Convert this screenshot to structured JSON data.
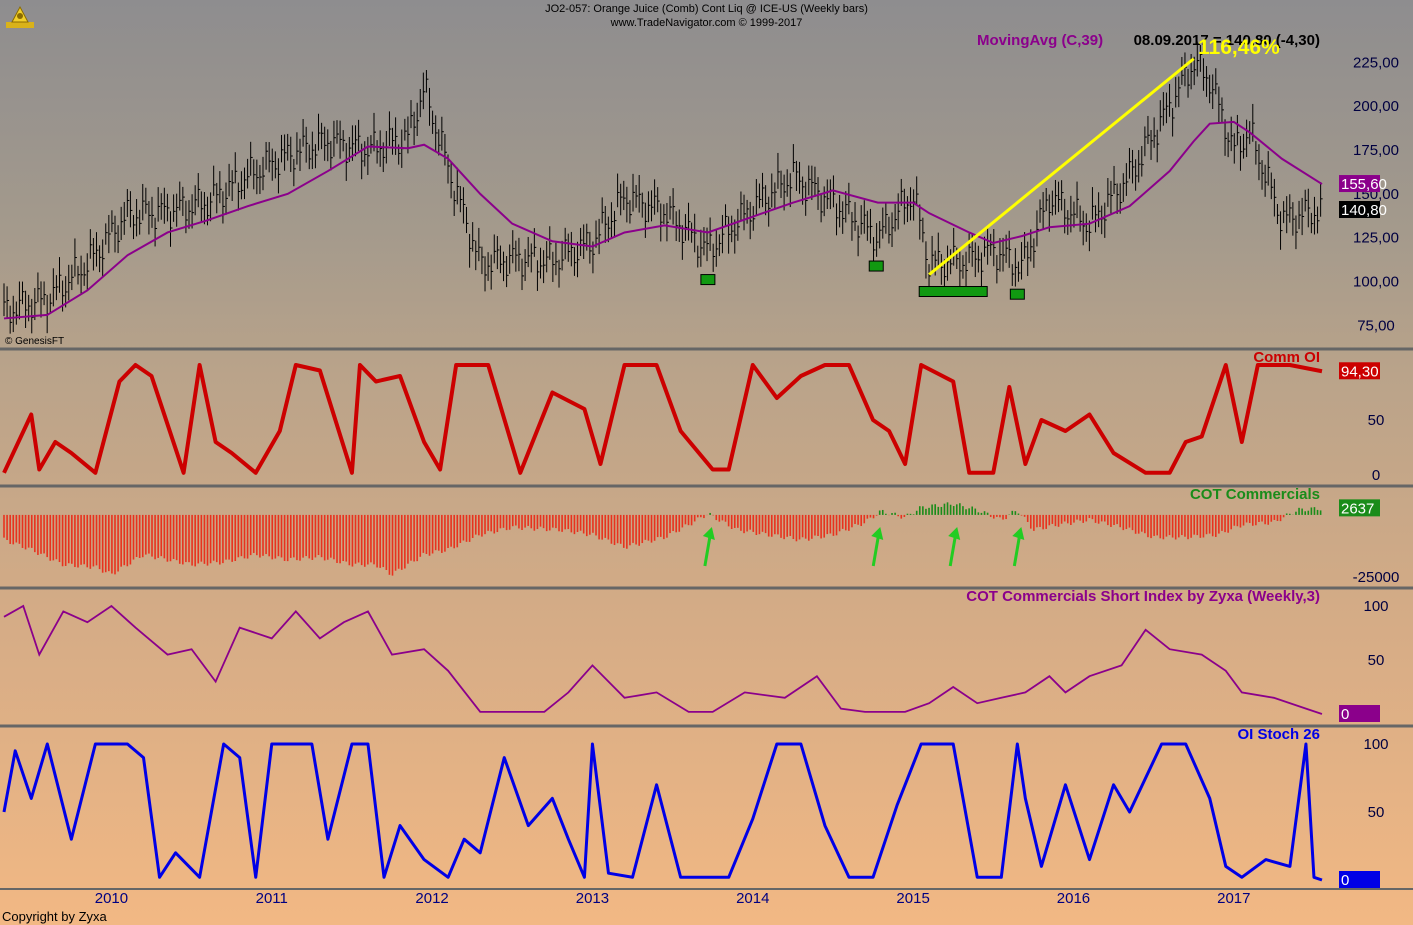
{
  "header": {
    "title": "JO2-057:  Orange Juice (Comb) Cont Liq @ ICE-US  (Weekly bars)",
    "subtitle": "www.TradeNavigator.com © 1999-2017"
  },
  "footer": {
    "copyright": "Copyright by Zyxa",
    "source": "© GenesisFT"
  },
  "colors": {
    "price": "#000000",
    "moving_avg": "#8b008b",
    "comm_oi": "#cc0000",
    "cot_negative": "#e8321e",
    "cot_positive": "#1a8c1a",
    "short_index": "#8b008b",
    "oi_stoch": "#0000e6",
    "trendline": "#ffff00",
    "markers": "#119911",
    "arrows": "#22cc22",
    "separator": "#666666"
  },
  "chart_data": [
    {
      "id": "price",
      "type": "line",
      "series_style": "ohlc-bars",
      "legend": "MovingAvg (C,39)",
      "legend_value": "08.09.2017 = 140,80 (-4,30)",
      "annotation": "116,46%",
      "ylim": [
        65,
        232
      ],
      "yticks": [
        "75,00",
        "100,00",
        "125,00",
        "150,00",
        "175,00",
        "200,00",
        "225,00"
      ],
      "ytick_values": [
        75,
        100,
        125,
        150,
        175,
        200,
        225
      ],
      "last_ma_label": "155,60",
      "last_price_label": "140,80",
      "x": [
        2009.33,
        2009.6,
        2009.85,
        2010.1,
        2010.35,
        2010.6,
        2010.85,
        2011.1,
        2011.35,
        2011.6,
        2011.85,
        2011.95,
        2012.1,
        2012.3,
        2012.5,
        2012.75,
        2013.0,
        2013.2,
        2013.45,
        2013.72,
        2014.0,
        2014.25,
        2014.5,
        2014.78,
        2015.0,
        2015.1,
        2015.35,
        2015.5,
        2015.68,
        2015.85,
        2016.1,
        2016.35,
        2016.6,
        2016.75,
        2016.85,
        2017.0,
        2017.1,
        2017.3,
        2017.55
      ],
      "close": [
        83,
        90,
        110,
        138,
        140,
        145,
        160,
        172,
        180,
        175,
        182,
        210,
        165,
        110,
        113,
        112,
        122,
        148,
        140,
        118,
        142,
        160,
        145,
        125,
        150,
        110,
        112,
        118,
        108,
        148,
        132,
        160,
        200,
        225,
        215,
        175,
        185,
        135,
        140.8
      ],
      "ma": [
        79,
        81,
        95,
        115,
        128,
        135,
        143,
        150,
        163,
        177,
        176,
        178,
        170,
        150,
        133,
        123,
        120,
        128,
        132,
        128,
        137,
        145,
        152,
        145,
        145,
        139,
        128,
        122,
        126,
        131,
        133,
        143,
        163,
        180,
        190,
        191,
        185,
        170,
        155.6
      ],
      "trendline": {
        "from": [
          2015.1,
          104
        ],
        "to": [
          2016.75,
          227
        ]
      },
      "markers_x": [
        2013.72,
        2014.77,
        2015.25,
        2015.65
      ]
    },
    {
      "id": "comm-oi",
      "type": "line",
      "legend": "Comm OI",
      "ylim": [
        0,
        100
      ],
      "yticks": [
        "0",
        "50"
      ],
      "ytick_values": [
        0,
        50
      ],
      "last_label": "94,30",
      "x": [
        2009.33,
        2009.5,
        2009.55,
        2009.65,
        2009.75,
        2009.9,
        2010.05,
        2010.15,
        2010.25,
        2010.45,
        2010.55,
        2010.65,
        2010.75,
        2010.9,
        2011.05,
        2011.15,
        2011.3,
        2011.5,
        2011.55,
        2011.65,
        2011.8,
        2011.95,
        2012.05,
        2012.15,
        2012.35,
        2012.55,
        2012.75,
        2012.95,
        2013.05,
        2013.2,
        2013.4,
        2013.55,
        2013.75,
        2013.85,
        2014.0,
        2014.15,
        2014.3,
        2014.45,
        2014.6,
        2014.75,
        2014.85,
        2014.95,
        2015.05,
        2015.25,
        2015.35,
        2015.5,
        2015.6,
        2015.7,
        2015.8,
        2015.95,
        2016.1,
        2016.25,
        2016.45,
        2016.6,
        2016.7,
        2016.8,
        2016.95,
        2017.05,
        2017.15,
        2017.35,
        2017.55
      ],
      "y": [
        2,
        55,
        5,
        30,
        20,
        2,
        85,
        100,
        90,
        2,
        100,
        30,
        20,
        2,
        40,
        100,
        95,
        2,
        100,
        85,
        90,
        30,
        5,
        100,
        100,
        2,
        75,
        60,
        10,
        100,
        100,
        40,
        5,
        5,
        100,
        70,
        90,
        100,
        100,
        50,
        40,
        10,
        100,
        85,
        2,
        2,
        80,
        10,
        50,
        40,
        55,
        20,
        2,
        2,
        30,
        35,
        100,
        30,
        100,
        100,
        94.3
      ]
    },
    {
      "id": "cot-commercials",
      "type": "bar",
      "legend": "COT Commercials",
      "ylim": [
        -27000,
        6000
      ],
      "yticks": [
        "-25000"
      ],
      "ytick_values": [
        -25000
      ],
      "last_label": "2637",
      "x": [
        2009.33,
        2009.5,
        2009.7,
        2009.9,
        2010.0,
        2010.2,
        2010.5,
        2010.7,
        2010.9,
        2011.1,
        2011.3,
        2011.5,
        2011.65,
        2011.75,
        2011.95,
        2012.1,
        2012.3,
        2012.5,
        2012.8,
        2013.0,
        2013.2,
        2013.45,
        2013.6,
        2013.72,
        2013.9,
        2014.1,
        2014.3,
        2014.5,
        2014.7,
        2014.8,
        2014.95,
        2015.05,
        2015.25,
        2015.4,
        2015.55,
        2015.65,
        2015.75,
        2015.9,
        2016.1,
        2016.3,
        2016.5,
        2016.7,
        2016.9,
        2017.05,
        2017.25,
        2017.4,
        2017.55
      ],
      "y": [
        -10000,
        -14000,
        -20000,
        -21000,
        -24000,
        -16000,
        -20000,
        -19000,
        -16000,
        -18000,
        -17000,
        -20000,
        -20000,
        -24000,
        -16000,
        -14000,
        -8000,
        -5000,
        -6000,
        -8000,
        -13000,
        -9000,
        -4000,
        500,
        -6000,
        -8000,
        -10000,
        -8000,
        -3000,
        1500,
        -1000,
        3000,
        4500,
        2000,
        -2000,
        2000,
        -6000,
        -4000,
        -2000,
        -5000,
        -9000,
        -9000,
        -8000,
        -4000,
        -3000,
        2000,
        2637
      ]
    },
    {
      "id": "cot-short-index",
      "type": "line",
      "legend": "COT Commercials Short Index by Zyxa (Weekly,3)",
      "ylim": [
        0,
        100
      ],
      "yticks": [
        "0",
        "50",
        "100"
      ],
      "ytick_values": [
        0,
        50,
        100
      ],
      "last_label": "0",
      "x": [
        2009.33,
        2009.45,
        2009.55,
        2009.7,
        2009.85,
        2010.0,
        2010.15,
        2010.35,
        2010.5,
        2010.65,
        2010.8,
        2011.0,
        2011.15,
        2011.3,
        2011.45,
        2011.6,
        2011.75,
        2011.95,
        2012.1,
        2012.3,
        2012.5,
        2012.7,
        2012.85,
        2013.0,
        2013.2,
        2013.4,
        2013.6,
        2013.75,
        2013.95,
        2014.2,
        2014.4,
        2014.55,
        2014.7,
        2014.95,
        2015.1,
        2015.25,
        2015.4,
        2015.55,
        2015.7,
        2015.85,
        2015.95,
        2016.1,
        2016.3,
        2016.45,
        2016.6,
        2016.8,
        2016.95,
        2017.05,
        2017.25,
        2017.45,
        2017.55
      ],
      "y": [
        90,
        100,
        55,
        95,
        85,
        100,
        80,
        55,
        60,
        30,
        80,
        70,
        95,
        70,
        85,
        95,
        55,
        60,
        40,
        2,
        2,
        2,
        20,
        45,
        15,
        20,
        2,
        2,
        20,
        15,
        35,
        5,
        2,
        2,
        10,
        25,
        10,
        15,
        20,
        35,
        20,
        35,
        45,
        78,
        60,
        55,
        40,
        20,
        15,
        5,
        0
      ]
    },
    {
      "id": "oi-stoch",
      "type": "line",
      "legend": "OI Stoch 26",
      "ylim": [
        0,
        100
      ],
      "yticks": [
        "0",
        "50",
        "100"
      ],
      "ytick_values": [
        0,
        50,
        100
      ],
      "last_label": "0",
      "x": [
        2009.33,
        2009.4,
        2009.5,
        2009.6,
        2009.75,
        2009.9,
        2010.0,
        2010.1,
        2010.2,
        2010.3,
        2010.4,
        2010.55,
        2010.7,
        2010.8,
        2010.9,
        2011.0,
        2011.1,
        2011.25,
        2011.35,
        2011.5,
        2011.6,
        2011.7,
        2011.8,
        2011.95,
        2012.1,
        2012.2,
        2012.3,
        2012.45,
        2012.6,
        2012.75,
        2012.85,
        2012.95,
        2013.0,
        2013.1,
        2013.25,
        2013.4,
        2013.55,
        2013.7,
        2013.85,
        2014.0,
        2014.15,
        2014.3,
        2014.45,
        2014.6,
        2014.75,
        2014.9,
        2015.05,
        2015.25,
        2015.4,
        2015.55,
        2015.65,
        2015.7,
        2015.8,
        2015.95,
        2016.1,
        2016.25,
        2016.35,
        2016.55,
        2016.7,
        2016.85,
        2016.95,
        2017.05,
        2017.2,
        2017.35,
        2017.45,
        2017.5,
        2017.55
      ],
      "y": [
        50,
        95,
        60,
        100,
        30,
        100,
        100,
        100,
        90,
        2,
        20,
        2,
        100,
        90,
        2,
        100,
        100,
        100,
        30,
        100,
        100,
        2,
        40,
        15,
        2,
        30,
        20,
        90,
        40,
        60,
        30,
        2,
        100,
        5,
        2,
        70,
        2,
        2,
        2,
        45,
        100,
        100,
        40,
        2,
        2,
        55,
        100,
        100,
        2,
        2,
        100,
        60,
        10,
        70,
        15,
        70,
        50,
        100,
        100,
        60,
        10,
        2,
        15,
        10,
        100,
        2,
        0
      ]
    }
  ],
  "xaxis": {
    "ticks": [
      "2010",
      "2011",
      "2012",
      "2013",
      "2014",
      "2015",
      "2016",
      "2017"
    ],
    "tick_values": [
      2010,
      2011,
      2012,
      2013,
      2014,
      2015,
      2016,
      2017
    ]
  }
}
